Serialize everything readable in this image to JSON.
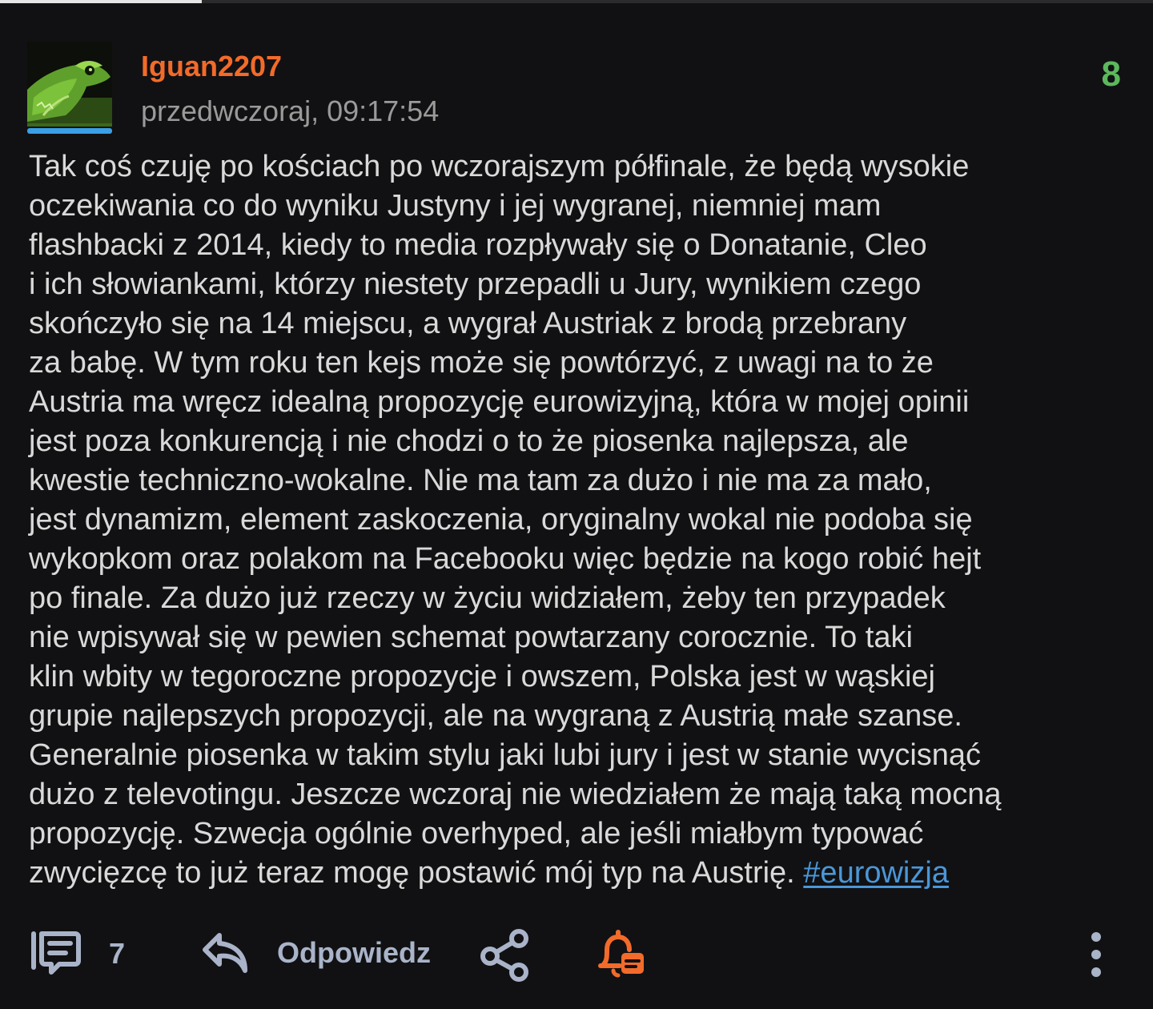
{
  "entry": {
    "author": "Iguan2207",
    "timestamp": "przedwczoraj, 09:17:54",
    "votes": "8",
    "body_lines": [
      "Tak coś czuję po kościach po wczorajszym półfinale, że będą wysokie",
      "oczekiwania co do wyniku Justyny i jej wygranej, niemniej mam",
      "flashbacki z 2014, kiedy to media rozpływały się o Donatanie, Cleo",
      "i ich słowiankami, którzy niestety przepadli u Jury, wynikiem czego",
      "skończyło się na 14 miejscu, a wygrał Austriak z brodą przebrany",
      "za babę. W tym roku ten kejs może się powtórzyć, z uwagi na to że",
      "Austria ma wręcz idealną propozycję eurowizyjną, która w mojej opinii",
      "jest poza konkurencją i nie chodzi o to że piosenka najlepsza, ale",
      "kwestie techniczno-wokalne. Nie ma tam za dużo i nie ma za mało,",
      "jest dynamizm, element zaskoczenia, oryginalny wokal nie podoba się",
      "wykopkom oraz polakom na Facebooku więc będzie na kogo robić hejt",
      "po finale. Za dużo już rzeczy w życiu widziałem, żeby ten przypadek",
      "nie wpisywał się w pewien schemat powtarzany corocznie. To taki",
      "klin wbity w tegoroczne propozycje i owszem, Polska jest w wąskiej",
      "grupie najlepszych propozycji, ale na wygraną z Austrią małe szanse.",
      "Generalnie piosenka w takim stylu jaki lubi jury i jest w stanie wycisnąć",
      "dużo z televotingu. Jeszcze wczoraj nie wiedziałem że mają taką mocną",
      "propozycję. Szwecja ogólnie overhyped, ale jeśli miałbym typować"
    ],
    "last_line_text": "zwycięzcę to już teraz mogę postawić mój typ na Austrię. ",
    "hashtag": "#eurowizja"
  },
  "actions": {
    "comments_count": "7",
    "reply_label": "Odpowiedz"
  },
  "icons": {
    "comments": "comments-icon",
    "reply": "reply-icon",
    "share": "share-icon",
    "notify": "notification-bell-icon",
    "more": "more-vertical-icon"
  },
  "colors": {
    "background": "#111113",
    "username": "#f26b2a",
    "votes": "#5cb85c",
    "link": "#4a97d8",
    "action": "#a9b4c9",
    "bell": "#f26b2a",
    "avatar_underline": "#3a9fe6"
  },
  "scroll_progress": 0.175
}
